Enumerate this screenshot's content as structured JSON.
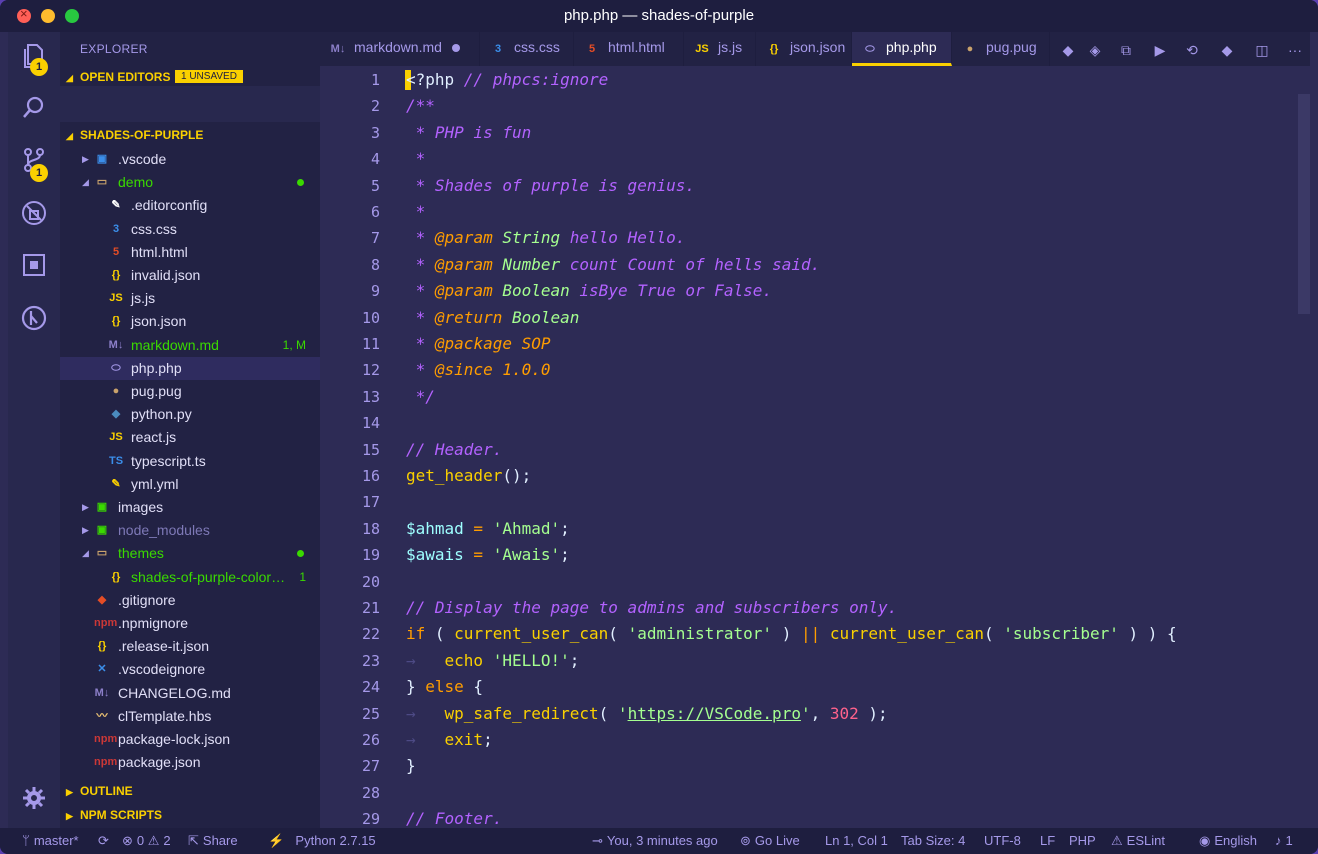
{
  "window": {
    "title": "php.php — shades-of-purple"
  },
  "activity_bar": {
    "items": [
      {
        "icon": "files-icon",
        "badge": "1"
      },
      {
        "icon": "search-icon"
      },
      {
        "icon": "source-control-icon",
        "badge": "1"
      },
      {
        "icon": "debug-icon"
      },
      {
        "icon": "extensions-icon"
      },
      {
        "icon": "gitlens-icon"
      },
      {
        "icon": "gear-icon"
      }
    ]
  },
  "sidebar": {
    "title": "EXPLORER",
    "open_editors": {
      "label": "OPEN EDITORS",
      "badge": "1 UNSAVED"
    },
    "project": {
      "label": "SHADES-OF-PURPLE"
    },
    "tree": [
      {
        "label": ".vscode",
        "icon": "folder-vscode-icon",
        "glyph": "▣",
        "color": "#3b8eea",
        "kind": "folder",
        "text_color": "#e1dff7"
      },
      {
        "label": "demo",
        "icon": "folder-open-icon",
        "glyph": "▭",
        "color": "#c9a26b",
        "kind": "folder-open",
        "text_color": "#3ad900",
        "dot": true
      },
      {
        "label": ".editorconfig",
        "icon": "editorconfig-icon",
        "glyph": "✎",
        "color": "#ffffff",
        "kind": "file",
        "text_color": "#e1dff7"
      },
      {
        "label": "css.css",
        "icon": "css-icon",
        "glyph": "3",
        "color": "#3b8eea",
        "kind": "file",
        "text_color": "#e1dff7"
      },
      {
        "label": "html.html",
        "icon": "html-icon",
        "glyph": "5",
        "color": "#e44d26",
        "kind": "file",
        "text_color": "#e1dff7"
      },
      {
        "label": "invalid.json",
        "icon": "json-icon",
        "glyph": "{}",
        "color": "#fad000",
        "kind": "file",
        "text_color": "#e1dff7"
      },
      {
        "label": "js.js",
        "icon": "js-icon",
        "glyph": "JS",
        "color": "#fad000",
        "kind": "file",
        "text_color": "#e1dff7"
      },
      {
        "label": "json.json",
        "icon": "json-icon",
        "glyph": "{}",
        "color": "#fad000",
        "kind": "file",
        "text_color": "#e1dff7"
      },
      {
        "label": "markdown.md",
        "icon": "markdown-icon",
        "glyph": "M↓",
        "color": "#8c7fc9",
        "kind": "file",
        "text_color": "#3ad900",
        "decoration": "1, M"
      },
      {
        "label": "php.php",
        "icon": "php-icon",
        "glyph": "⬭",
        "color": "#a599e9",
        "kind": "file",
        "text_color": "#e1dff7",
        "active": true
      },
      {
        "label": "pug.pug",
        "icon": "pug-icon",
        "glyph": "●",
        "color": "#c9a26b",
        "kind": "file",
        "text_color": "#e1dff7"
      },
      {
        "label": "python.py",
        "icon": "python-icon",
        "glyph": "◆",
        "color": "#4b8bbe",
        "kind": "file",
        "text_color": "#e1dff7"
      },
      {
        "label": "react.js",
        "icon": "js-icon",
        "glyph": "JS",
        "color": "#fad000",
        "kind": "file",
        "text_color": "#e1dff7"
      },
      {
        "label": "typescript.ts",
        "icon": "typescript-icon",
        "glyph": "TS",
        "color": "#3b8eea",
        "kind": "file",
        "text_color": "#e1dff7"
      },
      {
        "label": "yml.yml",
        "icon": "yaml-icon",
        "glyph": "✎",
        "color": "#fad000",
        "kind": "file",
        "text_color": "#e1dff7"
      },
      {
        "label": "images",
        "icon": "folder-images-icon",
        "glyph": "▣",
        "color": "#3ad900",
        "kind": "folder",
        "text_color": "#e1dff7"
      },
      {
        "label": "node_modules",
        "icon": "folder-node-icon",
        "glyph": "▣",
        "color": "#3ad900",
        "kind": "folder",
        "text_color": "#7e79b7"
      },
      {
        "label": "themes",
        "icon": "folder-open-icon",
        "glyph": "▭",
        "color": "#c9a26b",
        "kind": "folder-open",
        "text_color": "#3ad900",
        "dot": true
      },
      {
        "label": "shades-of-purple-color…",
        "icon": "json-icon",
        "glyph": "{}",
        "color": "#fad000",
        "kind": "file2",
        "text_color": "#3ad900",
        "decoration": "1"
      },
      {
        "label": ".gitignore",
        "icon": "git-icon",
        "glyph": "◆",
        "color": "#e44d26",
        "kind": "file0",
        "text_color": "#e1dff7"
      },
      {
        "label": ".npmignore",
        "icon": "npm-icon",
        "glyph": "npm",
        "color": "#cb3837",
        "kind": "file0",
        "text_color": "#e1dff7"
      },
      {
        "label": ".release-it.json",
        "icon": "json-icon",
        "glyph": "{}",
        "color": "#fad000",
        "kind": "file0",
        "text_color": "#e1dff7"
      },
      {
        "label": ".vscodeignore",
        "icon": "vscode-icon",
        "glyph": "✕",
        "color": "#3b8eea",
        "kind": "file0",
        "text_color": "#e1dff7"
      },
      {
        "label": "CHANGELOG.md",
        "icon": "markdown-icon",
        "glyph": "M↓",
        "color": "#8c7fc9",
        "kind": "file0",
        "text_color": "#e1dff7"
      },
      {
        "label": "clTemplate.hbs",
        "icon": "handlebars-icon",
        "glyph": "〰",
        "color": "#f0c674",
        "kind": "file0",
        "text_color": "#e1dff7"
      },
      {
        "label": "package-lock.json",
        "icon": "npm-icon",
        "glyph": "npm",
        "color": "#cb3837",
        "kind": "file0",
        "text_color": "#e1dff7"
      },
      {
        "label": "package.json",
        "icon": "npm-icon",
        "glyph": "npm",
        "color": "#cb3837",
        "kind": "file0",
        "text_color": "#e1dff7"
      }
    ],
    "outline": {
      "label": "OUTLINE"
    },
    "npm_scripts": {
      "label": "NPM SCRIPTS"
    }
  },
  "tabs": [
    {
      "label": "markdown.md",
      "icon": "markdown-icon",
      "glyph": "M↓",
      "color": "#8c7fc9",
      "dirty": true
    },
    {
      "label": "css.css",
      "icon": "css-icon",
      "glyph": "3",
      "color": "#3b8eea"
    },
    {
      "label": "html.html",
      "icon": "html-icon",
      "glyph": "5",
      "color": "#e44d26"
    },
    {
      "label": "js.js",
      "icon": "js-icon",
      "glyph": "JS",
      "color": "#fad000"
    },
    {
      "label": "json.json",
      "icon": "json-icon",
      "glyph": "{}",
      "color": "#fad000"
    },
    {
      "label": "php.php",
      "icon": "php-icon",
      "glyph": "⬭",
      "color": "#a599e9",
      "active": true
    },
    {
      "label": "pug.pug",
      "icon": "pug-icon",
      "glyph": "●",
      "color": "#c9a26b"
    }
  ],
  "editor_toolbar": [
    {
      "name": "python-run-icon",
      "glyph": "◆"
    },
    {
      "name": "gitlens-commit-icon",
      "glyph": "◈"
    },
    {
      "name": "compare-icon",
      "glyph": "⧉"
    },
    {
      "name": "run-icon",
      "glyph": "▶"
    },
    {
      "name": "diff-icon",
      "glyph": "⟲"
    },
    {
      "name": "git-icon",
      "glyph": "◆"
    },
    {
      "name": "split-editor-icon",
      "glyph": "◫"
    },
    {
      "name": "more-actions-icon",
      "glyph": "···"
    }
  ],
  "editor": {
    "lines": [
      [
        [
          "<?php ",
          "#e1efff"
        ],
        [
          "// phpcs:ignore",
          "#b362ff",
          "i"
        ]
      ],
      [
        [
          "/**",
          "#b362ff",
          "i"
        ]
      ],
      [
        [
          " * PHP is fun",
          "#b362ff",
          "i"
        ]
      ],
      [
        [
          " *",
          "#b362ff",
          "i"
        ]
      ],
      [
        [
          " * Shades of purple is genius.",
          "#b362ff",
          "i"
        ]
      ],
      [
        [
          " *",
          "#b362ff",
          "i"
        ]
      ],
      [
        [
          " * ",
          "#b362ff",
          "i"
        ],
        [
          "@param",
          "#ff9d00",
          "i"
        ],
        [
          " ",
          "#b362ff",
          "i"
        ],
        [
          "String",
          "#a5ff90",
          "i"
        ],
        [
          " hello Hello.",
          "#b362ff",
          "i"
        ]
      ],
      [
        [
          " * ",
          "#b362ff",
          "i"
        ],
        [
          "@param",
          "#ff9d00",
          "i"
        ],
        [
          " ",
          "#b362ff",
          "i"
        ],
        [
          "Number",
          "#a5ff90",
          "i"
        ],
        [
          " count Count of hells said.",
          "#b362ff",
          "i"
        ]
      ],
      [
        [
          " * ",
          "#b362ff",
          "i"
        ],
        [
          "@param",
          "#ff9d00",
          "i"
        ],
        [
          " ",
          "#b362ff",
          "i"
        ],
        [
          "Boolean",
          "#a5ff90",
          "i"
        ],
        [
          " isBye True or False.",
          "#b362ff",
          "i"
        ]
      ],
      [
        [
          " * ",
          "#b362ff",
          "i"
        ],
        [
          "@return",
          "#ff9d00",
          "i"
        ],
        [
          " ",
          "#b362ff",
          "i"
        ],
        [
          "Boolean",
          "#a5ff90",
          "i"
        ]
      ],
      [
        [
          " * ",
          "#b362ff",
          "i"
        ],
        [
          "@package",
          "#ff9d00",
          "i"
        ],
        [
          " SOP",
          "#ff9d00",
          "i"
        ]
      ],
      [
        [
          " * ",
          "#b362ff",
          "i"
        ],
        [
          "@since",
          "#ff9d00",
          "i"
        ],
        [
          " 1.0.0",
          "#ff9d00",
          "i"
        ]
      ],
      [
        [
          " */",
          "#b362ff",
          "i"
        ]
      ],
      [],
      [
        [
          "// Header.",
          "#b362ff",
          "i"
        ]
      ],
      [
        [
          "get_header",
          "#fad000"
        ],
        [
          "();",
          "#e1efff"
        ]
      ],
      [],
      [
        [
          "$ahmad",
          "#9effff"
        ],
        [
          " = ",
          "#ff9d00"
        ],
        [
          "'Ahmad'",
          "#a5ff90"
        ],
        [
          ";",
          "#e1efff"
        ]
      ],
      [
        [
          "$awais",
          "#9effff"
        ],
        [
          " = ",
          "#ff9d00"
        ],
        [
          "'Awais'",
          "#a5ff90"
        ],
        [
          ";",
          "#e1efff"
        ]
      ],
      [],
      [
        [
          "// Display the page to admins and subscribers only.",
          "#b362ff",
          "i"
        ]
      ],
      [
        [
          "if",
          "#ff9d00"
        ],
        [
          " ( ",
          "#e1efff"
        ],
        [
          "current_user_can",
          "#fad000"
        ],
        [
          "( ",
          "#e1efff"
        ],
        [
          "'administrator'",
          "#a5ff90"
        ],
        [
          " ) ",
          "#e1efff"
        ],
        [
          "||",
          "#ff9d00"
        ],
        [
          " ",
          "#e1efff"
        ],
        [
          "current_user_can",
          "#fad000"
        ],
        [
          "( ",
          "#e1efff"
        ],
        [
          "'subscriber'",
          "#a5ff90"
        ],
        [
          " ) ) {",
          "#e1efff"
        ]
      ],
      [
        [
          "→   ",
          "#4d4a85"
        ],
        [
          "echo",
          "#fad000"
        ],
        [
          " ",
          "#e1efff"
        ],
        [
          "'HELLO!'",
          "#a5ff90"
        ],
        [
          ";",
          "#e1efff"
        ]
      ],
      [
        [
          "} ",
          "#e1efff"
        ],
        [
          "else",
          "#ff9d00"
        ],
        [
          " {",
          "#e1efff"
        ]
      ],
      [
        [
          "→   ",
          "#4d4a85"
        ],
        [
          "wp_safe_redirect",
          "#fad000"
        ],
        [
          "( ",
          "#e1efff"
        ],
        [
          "'",
          "#a5ff90"
        ],
        [
          "https://VSCode.pro",
          "#a5ff90",
          "u"
        ],
        [
          "'",
          "#a5ff90"
        ],
        [
          ", ",
          "#e1efff"
        ],
        [
          "302",
          "#ff628c"
        ],
        [
          " );",
          "#e1efff"
        ]
      ],
      [
        [
          "→   ",
          "#4d4a85"
        ],
        [
          "exit",
          "#fad000"
        ],
        [
          ";",
          "#e1efff"
        ]
      ],
      [
        [
          "}",
          "#e1efff"
        ]
      ],
      [],
      [
        [
          "// Footer.",
          "#b362ff",
          "i"
        ]
      ]
    ]
  },
  "statusbar": {
    "branch": "master*",
    "sync": "",
    "errors": "0",
    "warnings": "2",
    "share": "Share",
    "python": "Python 2.7.15",
    "blame": "You, 3 minutes ago",
    "golive": "Go Live",
    "position": "Ln 1, Col 1",
    "tabsize": "Tab Size: 4",
    "encoding": "UTF-8",
    "eol": "LF",
    "language": "PHP",
    "eslint": "ESLint",
    "locale": "English",
    "notifications": "1"
  }
}
